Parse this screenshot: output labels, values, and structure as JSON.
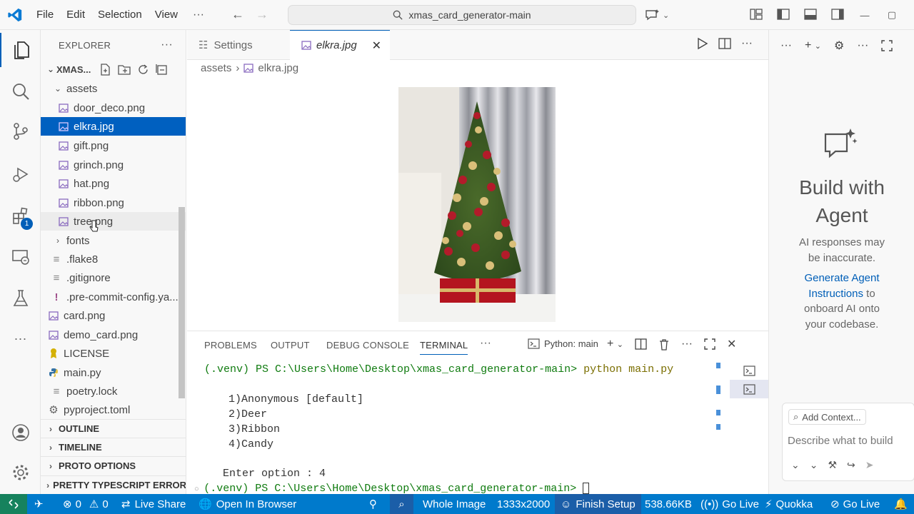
{
  "titlebar": {
    "menus": [
      "File",
      "Edit",
      "Selection",
      "View"
    ],
    "search_text": "xmas_card_generator-main"
  },
  "activity": {
    "extensions_badge": "1"
  },
  "explorer": {
    "header": "EXPLORER",
    "root": "XMAS...",
    "folder_assets": "assets",
    "assets_files": [
      "door_deco.png",
      "elkra.jpg",
      "gift.png",
      "grinch.png",
      "hat.png",
      "ribbon.png",
      "tree.png"
    ],
    "folder_fonts": "fonts",
    "root_files": [
      ".flake8",
      ".gitignore",
      ".pre-commit-config.ya...",
      "card.png",
      "demo_card.png",
      "LICENSE",
      "main.py",
      "poetry.lock",
      "pyproject.toml"
    ],
    "sections": [
      "OUTLINE",
      "TIMELINE",
      "PROTO OPTIONS",
      "PRETTY TYPESCRIPT ERROR"
    ]
  },
  "tabs": {
    "settings": "Settings",
    "active": "elkra.jpg"
  },
  "breadcrumb": {
    "folder": "assets",
    "file": "elkra.jpg"
  },
  "panel": {
    "tabs": [
      "PROBLEMS",
      "OUTPUT",
      "DEBUG CONSOLE",
      "TERMINAL"
    ],
    "terminal_name": "Python: main",
    "prompt": "(.venv) PS C:\\Users\\Home\\Desktop\\xmas_card_generator-main>",
    "command": "python main.py",
    "options": [
      "1)Anonymous [default]",
      "2)Deer",
      "3)Ribbon",
      "4)Candy"
    ],
    "enter_option": "Enter option : 4"
  },
  "chat": {
    "title_line1": "Build with",
    "title_line2": "Agent",
    "disclaimer_1": "AI responses may",
    "disclaimer_2": "be inaccurate.",
    "link_1": "Generate Agent",
    "link_2": "Instructions",
    "text_2": "to",
    "text_3": "onboard AI onto",
    "text_4": "your codebase.",
    "add_context": "Add Context...",
    "input_placeholder": "Describe what to build"
  },
  "status": {
    "errors": "0",
    "warnings": "0",
    "live_share": "Live Share",
    "open_browser": "Open In Browser",
    "whole_image": "Whole Image",
    "dimensions": "1333x2000",
    "finish_setup": "Finish Setup",
    "file_size": "538.66KB",
    "go_live_1": "Go Live",
    "quokka": "Quokka",
    "go_live_2": "Go Live"
  },
  "colors": {
    "accent": "#005fb8",
    "statusbar": "#007acc",
    "selection": "#0060c0"
  }
}
